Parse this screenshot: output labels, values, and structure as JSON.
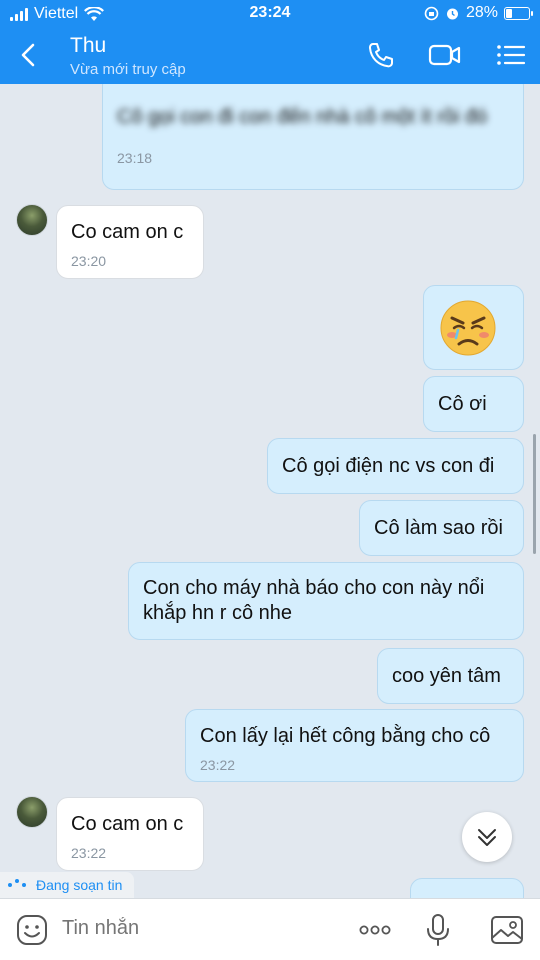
{
  "status_bar": {
    "carrier": "Viettel",
    "time": "23:24",
    "battery": "28%",
    "battery_level": 0.28
  },
  "header": {
    "contact_name": "Thu",
    "subtitle": "Vừa mới truy cập",
    "icons": [
      "back-icon",
      "phone-icon",
      "video-call-icon",
      "menu-icon"
    ]
  },
  "messages": [
    {
      "side": "me",
      "text": "Cô gọi con đi con đến nhà cô một ít rồi đó",
      "time": "23:18",
      "blurred": true
    },
    {
      "side": "them",
      "text": "Co cam on c",
      "time": "23:20"
    },
    {
      "side": "me",
      "sticker": "crying-angry-emoji"
    },
    {
      "side": "me",
      "text": "Cô ơi"
    },
    {
      "side": "me",
      "text": "Cô gọi điện nc vs con đi"
    },
    {
      "side": "me",
      "text": "Cô làm sao rồi"
    },
    {
      "side": "me",
      "text_line1": "Con cho máy nhà báo cho con này nổi",
      "text_line2": "khắp hn r cô nhe"
    },
    {
      "side": "me",
      "text": "coo yên tâm"
    },
    {
      "side": "me",
      "text": "Con lấy lại hết công bằng cho cô",
      "time": "23:22"
    },
    {
      "side": "them",
      "text": "Co cam on c",
      "time": "23:22"
    }
  ],
  "typing_indicator": "Đang soạn tin",
  "input": {
    "placeholder": "Tin nhắn",
    "icons": [
      "emoji-icon",
      "more-icon",
      "microphone-icon",
      "image-icon"
    ]
  },
  "colors": {
    "header": "#1e8ff3",
    "background": "#e2e8ef",
    "my_bubble": "#d5eefd",
    "their_bubble": "#ffffff"
  }
}
